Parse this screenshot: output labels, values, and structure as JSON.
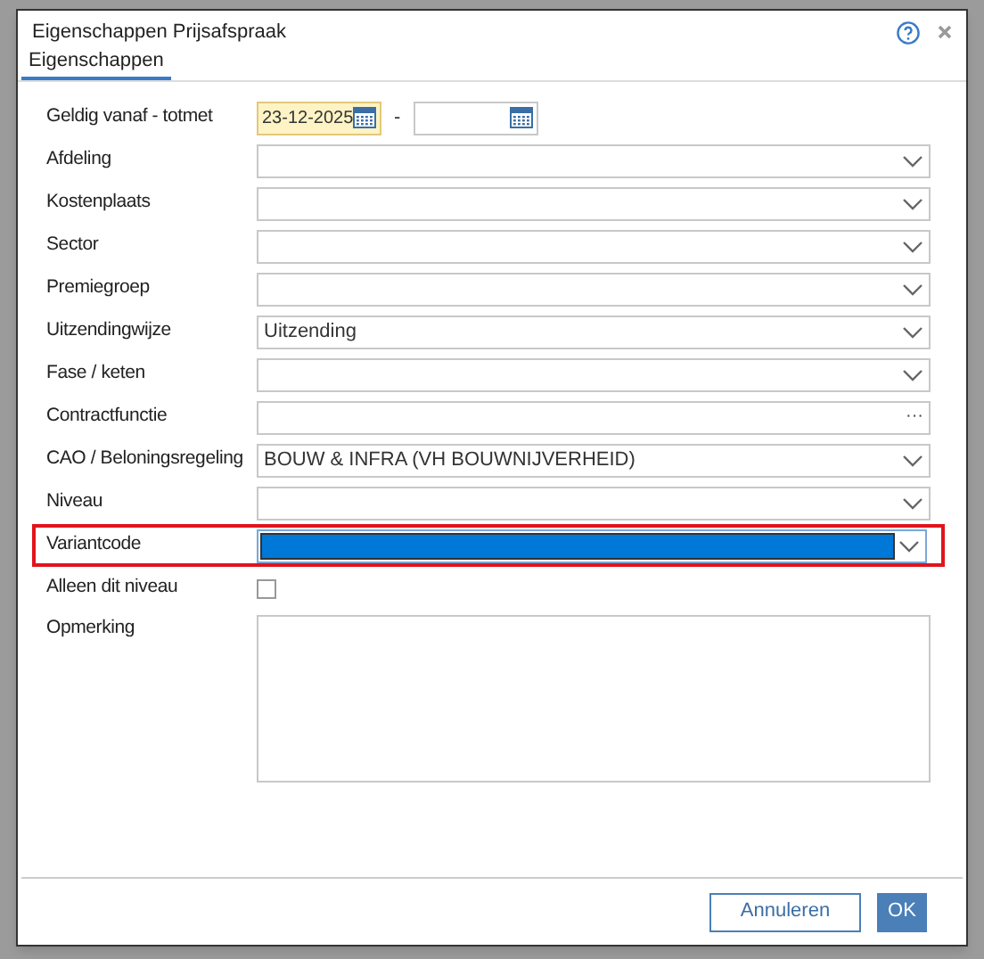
{
  "dialog": {
    "title": "Eigenschappen Prijsafspraak"
  },
  "tabs": [
    {
      "label": "Eigenschappen",
      "selected": true
    }
  ],
  "fields": [
    {
      "kind": "daterange",
      "label": "Geldig vanaf - totmet",
      "from": "23-12-2025",
      "separator": "-"
    },
    {
      "kind": "select",
      "label": "Afdeling",
      "highlighted": false
    },
    {
      "kind": "select",
      "label": "Kostenplaats",
      "highlighted": false
    },
    {
      "kind": "select",
      "label": "Sector",
      "highlighted": false
    },
    {
      "kind": "select",
      "label": "Premiegroep",
      "highlighted": false
    },
    {
      "kind": "select",
      "label": "Uitzendingwijze",
      "value": "Uitzending",
      "highlighted": false
    },
    {
      "kind": "select",
      "label": "Fase / keten",
      "highlighted": false
    },
    {
      "kind": "lookup",
      "label": "Contractfunctie",
      "button": "···"
    },
    {
      "kind": "select",
      "label": "CAO / Beloningsregeling",
      "value": "BOUW & INFRA (VH BOUWNIJVERHEID)",
      "highlighted": false
    },
    {
      "kind": "select",
      "label": "Niveau",
      "highlighted": false
    },
    {
      "kind": "select",
      "label": "Variantcode",
      "highlighted": true
    },
    {
      "kind": "checkbox",
      "label": "Alleen dit niveau",
      "checked": false
    },
    {
      "kind": "textarea",
      "label": "Opmerking"
    }
  ],
  "buttons": [
    {
      "label": "Annuleren",
      "primary": false
    },
    {
      "label": "OK",
      "primary": true
    }
  ]
}
